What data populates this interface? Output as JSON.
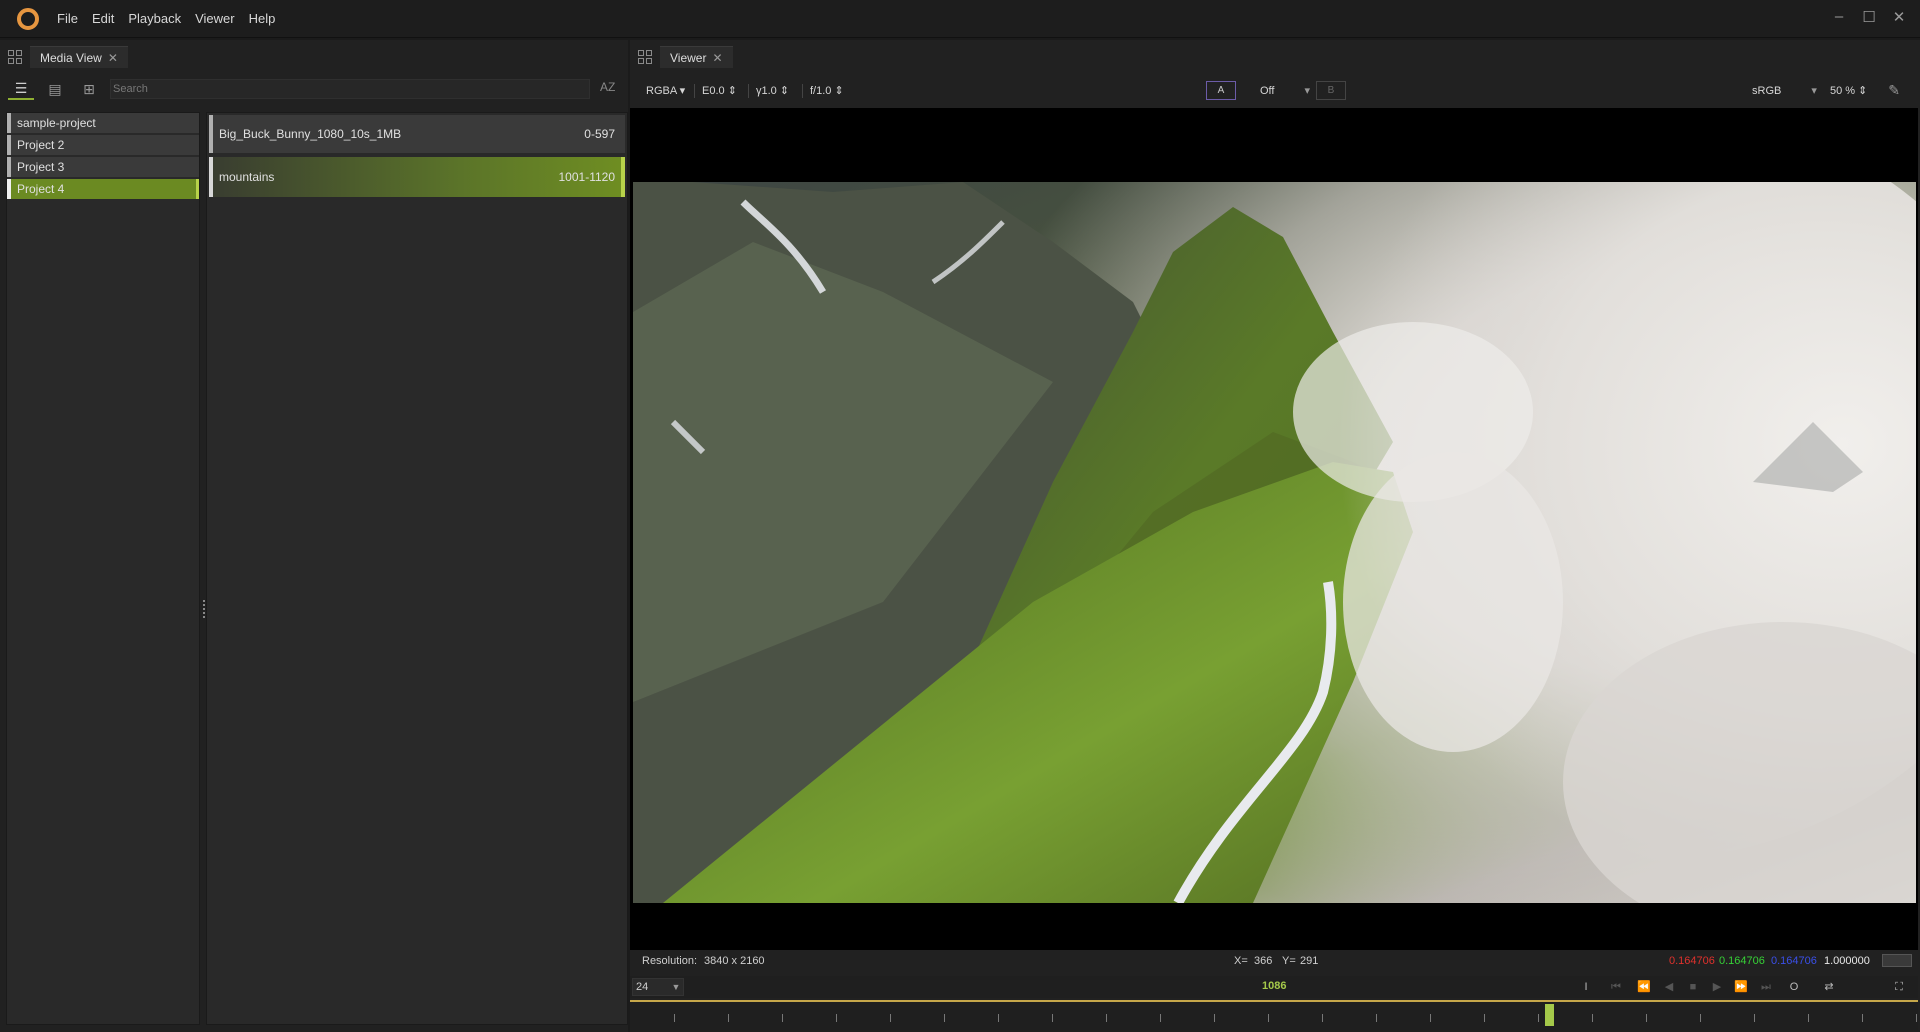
{
  "menu": {
    "items": [
      "File",
      "Edit",
      "Playback",
      "Viewer",
      "Help"
    ]
  },
  "media_panel": {
    "tab_label": "Media View",
    "search_placeholder": "Search",
    "sort_label": "AZ",
    "projects": [
      "sample-project",
      "Project 2",
      "Project 3",
      "Project 4"
    ],
    "selected_project": "Project 4",
    "media": [
      {
        "name": "Big_Buck_Bunny_1080_10s_1MB",
        "range": "0-597"
      },
      {
        "name": "mountains",
        "range": "1001-1120"
      }
    ]
  },
  "viewer": {
    "tab_label": "Viewer",
    "channel": "RGBA",
    "exposure": "E0.0",
    "gamma": "γ1.0",
    "fstop": "f/1.0",
    "compare_a": "A",
    "compare_mode": "Off",
    "compare_b": "B",
    "display": "sRGB",
    "zoom": "50 %",
    "resolution_label": "Resolution:",
    "resolution_value": "3840 x 2160",
    "coord_x_label": "X=",
    "coord_x": "366",
    "coord_y_label": "Y=",
    "coord_y": "291",
    "pixel_r": "0.164706",
    "pixel_g": "0.164706",
    "pixel_b": "0.164706",
    "pixel_a": "1.000000",
    "fps": "24",
    "current_frame": "1086"
  },
  "colors": {
    "accent": "#a5c94a",
    "selected": "#6b8a22",
    "logo": "#e69640"
  }
}
